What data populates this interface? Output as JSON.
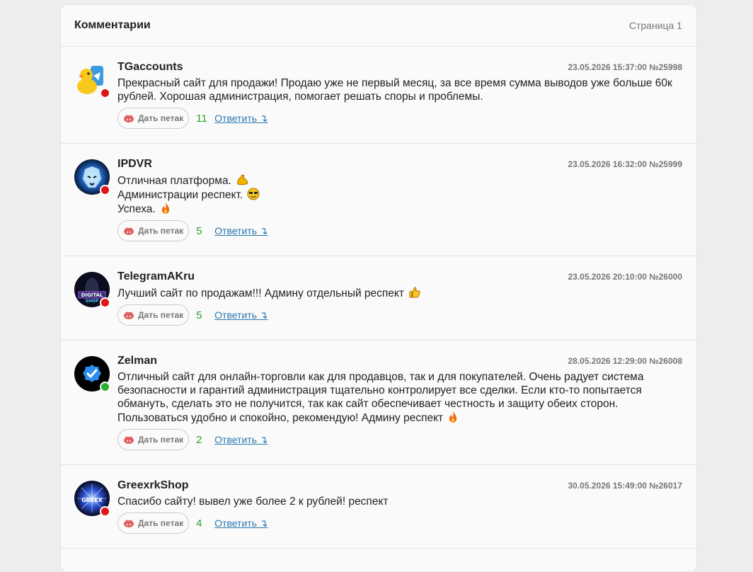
{
  "header": {
    "title": "Комментарии",
    "page": "Страница 1"
  },
  "like_label": "Дать петак",
  "reply_label": "Ответить ↴",
  "status_colors": {
    "offline": "#e01515",
    "online": "#2cb12c"
  },
  "comments": [
    {
      "user": "TGaccounts",
      "meta": "23.05.2026 15:37:00 №25998",
      "status": "offline",
      "avatar_icon": "duck-telegram-avatar",
      "lines": [
        "Прекрасный сайт для продажи! Продаю уже не первый месяц, за все время сумма выводов уже больше 60к рублей. Хорошая администрация, помогает решать споры и проблемы."
      ],
      "likes": "11"
    },
    {
      "user": "IPDVR",
      "meta": "23.05.2026 16:32:00 №25999",
      "status": "offline",
      "avatar_icon": "tiger-avatar",
      "lines": [
        "Отличная платформа.",
        "Администрации респект.",
        "Успеха."
      ],
      "emojis": [
        "flexed-biceps-icon",
        "sunglasses-face-icon",
        "fire-icon"
      ],
      "likes": "5"
    },
    {
      "user": "TelegramAKru",
      "meta": "23.05.2026 20:10:00 №26000",
      "status": "offline",
      "avatar_icon": "digital-shop-avatar",
      "lines": [
        "Лучший сайт по продажам!!! Админу отдельный респект"
      ],
      "emojis": [
        "thumbs-up-icon"
      ],
      "likes": "5"
    },
    {
      "user": "Zelman",
      "meta": "28.05.2026 12:29:00 №26008",
      "status": "online",
      "avatar_icon": "verified-check-avatar",
      "lines": [
        "Отличный сайт для онлайн-торговли как для продавцов, так и для покупателей. Очень радует система безопасности и гарантий администрация тщательно контролирует все сделки. Если кто-то попытается обмануть, сделать это не получится, так как сайт обеспечивает честность и защиту обеих сторон. Пользоваться удобно и спокойно, рекомендую! Админу респект"
      ],
      "emojis": [
        "fire-icon"
      ],
      "likes": "2"
    },
    {
      "user": "GreexrkShop",
      "meta": "30.05.2026 15:49:00 №26017",
      "status": "offline",
      "avatar_icon": "greexrk-shop-avatar",
      "lines": [
        "Спасибо сайту! вывел уже более 2 к рублей! респект"
      ],
      "likes": "4"
    }
  ]
}
